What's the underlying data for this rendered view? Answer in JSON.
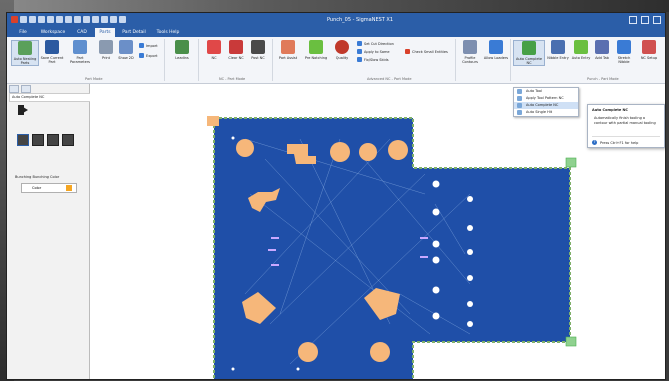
{
  "window_title": "Punch_05 - SigmaNEST X1",
  "tabs": [
    {
      "label": "File"
    },
    {
      "label": "Workspace"
    },
    {
      "label": "CAD"
    },
    {
      "label": "Parts"
    },
    {
      "label": "Part Detail"
    },
    {
      "label": "Tools Help"
    }
  ],
  "ribbon": {
    "buttons": {
      "auto_nest": "Auto Nesting Parts",
      "save_part": "Save Current Part",
      "part_params": "Part Parameters",
      "print": "Print",
      "show_2d": "Show 2D",
      "import": "Import",
      "export": "Export",
      "leadins": "Leadins",
      "nc": "NC",
      "clear_nc": "Clear NC",
      "post_nc": "Post NC",
      "part_assist": "Part Assist",
      "pre_notching": "Pre Notching",
      "quality": "Quality",
      "profile_contours": "Profile Contours",
      "allow_loaders": "Allow Loaders",
      "auto_complete": "Auto Complete NC",
      "nibble": "Nibble Entry",
      "auto_entry": "Auto Entry",
      "add_tab": "Add Tab",
      "stretch_nibble": "Stretch Nibble",
      "nc_setup": "NC Setup"
    },
    "small": {
      "set_cut_direction": "Set Cut Direction",
      "apply_to_same": "Apply to Same",
      "check_small_entities": "Check Small Entities",
      "fix_slow_skids": "Fix/Slow Skids"
    },
    "groups": {
      "part_mode": "Part Mode",
      "nc_part_mode": "NC - Part Mode",
      "adv_nc": "Advanced NC - Part Mode",
      "punch": "Punch - Part Mode"
    }
  },
  "dropdown": {
    "items": [
      "Auto Tool",
      "Apply Tool Pattern NC",
      "Auto Complete NC",
      "Auto Single Hit"
    ],
    "highlighted": "Auto Complete NC"
  },
  "tooltip": {
    "title": "Auto Complete NC",
    "body": "Automatically finish tooling a contour with partial manual tooling",
    "help": "Press Ctrl+F1 for help"
  },
  "panel": {
    "title": "Auto Complete NC",
    "bunching_label": "Bunching Bunching Color",
    "color_label": "Color"
  },
  "colors": {
    "part_fill": "#1f4fa8",
    "feature_fill": "#f6b77a",
    "ribbon_accent": "#2b5ea8",
    "grid_green": "#4caf50"
  }
}
